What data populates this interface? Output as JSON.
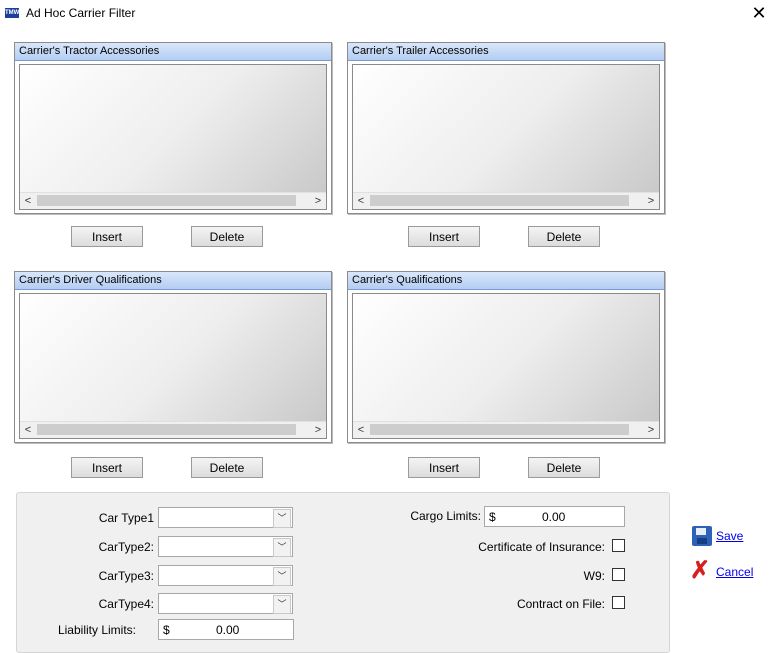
{
  "window": {
    "title": "Ad Hoc Carrier Filter",
    "icon_text": "TMW"
  },
  "icons": {
    "close": "close-icon",
    "save": "save-disk-icon",
    "cancel": "cancel-x-icon"
  },
  "scroll_arrows": {
    "left": "<",
    "right": ">"
  },
  "panels": [
    {
      "title": "Carrier's Tractor Accessories",
      "insert_label": "Insert",
      "delete_label": "Delete"
    },
    {
      "title": "Carrier's Trailer Accessories",
      "insert_label": "Insert",
      "delete_label": "Delete"
    },
    {
      "title": "Carrier's Driver Qualifications",
      "insert_label": "Insert",
      "delete_label": "Delete"
    },
    {
      "title": "Carrier's Qualifications",
      "insert_label": "Insert",
      "delete_label": "Delete"
    }
  ],
  "filters": {
    "car_type1": {
      "label": "Car Type1",
      "value": ""
    },
    "car_type2": {
      "label": "CarType2:",
      "value": ""
    },
    "car_type3": {
      "label": "CarType3:",
      "value": ""
    },
    "car_type4": {
      "label": "CarType4:",
      "value": ""
    },
    "liability": {
      "label": "Liability Limits:",
      "currency": "$",
      "value": "0.00"
    },
    "cargo": {
      "label": "Cargo Limits:",
      "currency": "$",
      "value": "0.00"
    },
    "certificate": {
      "label": "Certificate of Insurance:",
      "checked": false
    },
    "w9": {
      "label": "W9:",
      "checked": false
    },
    "contract": {
      "label": "Contract on File:",
      "checked": false
    }
  },
  "actions": {
    "save_label": "Save",
    "cancel_label": "Cancel"
  }
}
